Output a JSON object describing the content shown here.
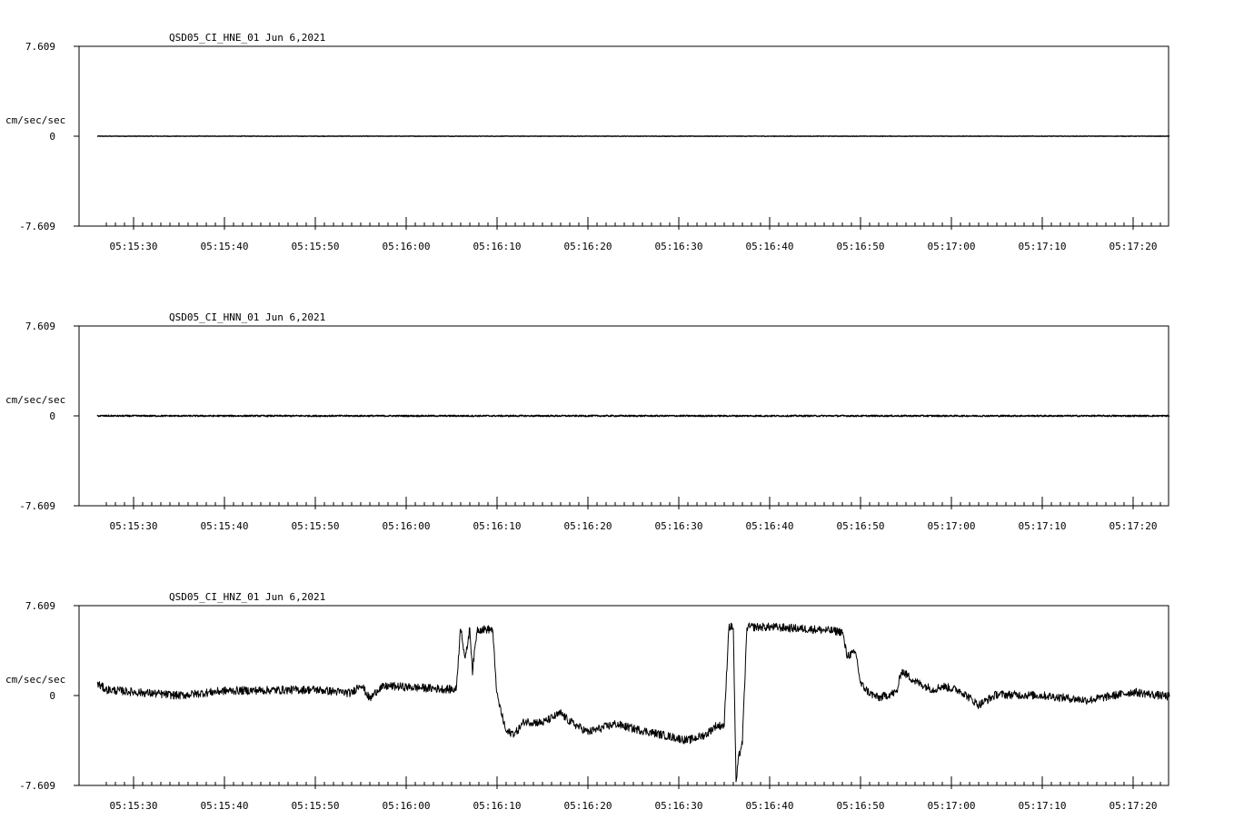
{
  "chart_data": [
    {
      "type": "line",
      "title": "QSD05_CI_HNE_01  Jun 6,2021",
      "ylabel": "cm/sec/sec",
      "ylim": [
        -7.609,
        7.609
      ],
      "y_ticks": [
        "7.609",
        "0",
        "-7.609"
      ],
      "x_ticks": [
        "05:15:30",
        "05:15:40",
        "05:15:50",
        "05:16:00",
        "05:16:10",
        "05:16:20",
        "05:16:30",
        "05:16:40",
        "05:16:50",
        "05:17:00",
        "05:17:10",
        "05:17:20"
      ],
      "series": [
        {
          "x": [
            "05:15:26",
            "05:15:40",
            "05:16:00",
            "05:16:20",
            "05:16:40",
            "05:17:00",
            "05:17:20",
            "05:17:24"
          ],
          "y": [
            0,
            0,
            0,
            0,
            0,
            0,
            0,
            0
          ]
        }
      ]
    },
    {
      "type": "line",
      "title": "QSD05_CI_HNN_01  Jun 6,2021",
      "ylabel": "cm/sec/sec",
      "ylim": [
        -7.609,
        7.609
      ],
      "y_ticks": [
        "7.609",
        "0",
        "-7.609"
      ],
      "x_ticks": [
        "05:15:30",
        "05:15:40",
        "05:15:50",
        "05:16:00",
        "05:16:10",
        "05:16:20",
        "05:16:30",
        "05:16:40",
        "05:16:50",
        "05:17:00",
        "05:17:10",
        "05:17:20"
      ],
      "series": [
        {
          "x": [
            "05:15:26",
            "05:15:40",
            "05:16:00",
            "05:16:20",
            "05:16:40",
            "05:17:00",
            "05:17:20",
            "05:17:24"
          ],
          "y": [
            0,
            0,
            0,
            0,
            0,
            0,
            0,
            0
          ]
        }
      ]
    },
    {
      "type": "line",
      "title": "QSD05_CI_HNZ_01  Jun 6,2021",
      "ylabel": "cm/sec/sec",
      "ylim": [
        -7.609,
        7.609
      ],
      "y_ticks": [
        "7.609",
        "0",
        "-7.609"
      ],
      "x_ticks": [
        "05:15:30",
        "05:15:40",
        "05:15:50",
        "05:16:00",
        "05:16:10",
        "05:16:20",
        "05:16:30",
        "05:16:40",
        "05:16:50",
        "05:17:00",
        "05:17:10",
        "05:17:20"
      ],
      "series": [
        {
          "x": [
            "05:15:26",
            "05:15:27",
            "05:15:30",
            "05:15:35",
            "05:15:40",
            "05:15:50",
            "05:15:54",
            "05:15:55",
            "05:15:56",
            "05:15:57",
            "05:15:58",
            "05:16:03",
            "05:16:05.5",
            "05:16:06",
            "05:16:06.5",
            "05:16:07",
            "05:16:07.3",
            "05:16:07.8",
            "05:16:08",
            "05:16:09.5",
            "05:16:10",
            "05:16:11",
            "05:16:12",
            "05:16:13",
            "05:16:15",
            "05:16:17",
            "05:16:18",
            "05:16:20",
            "05:16:23",
            "05:16:25",
            "05:16:28",
            "05:16:31",
            "05:16:33",
            "05:16:34",
            "05:16:35",
            "05:16:35.5",
            "05:16:36",
            "05:16:36.3",
            "05:16:36.6",
            "05:16:37",
            "05:16:37.5",
            "05:16:37.8",
            "05:16:40",
            "05:16:45",
            "05:16:48",
            "05:16:48.5",
            "05:16:49.5",
            "05:16:50",
            "05:16:51",
            "05:16:52",
            "05:16:54",
            "05:16:54.5",
            "05:16:56",
            "05:16:58",
            "05:16:59",
            "05:17:01",
            "05:17:03",
            "05:17:05",
            "05:17:10",
            "05:17:15",
            "05:17:20",
            "05:17:24"
          ],
          "y": [
            1.0,
            0.5,
            0.3,
            0.0,
            0.4,
            0.5,
            0.2,
            1.0,
            -0.3,
            0.6,
            0.8,
            0.6,
            0.5,
            5.9,
            3.0,
            5.7,
            2.1,
            5.6,
            5.6,
            5.6,
            0.0,
            -3.1,
            -3.2,
            -2.2,
            -2.3,
            -1.5,
            -2.2,
            -3.1,
            -2.4,
            -2.8,
            -3.3,
            -3.8,
            -3.3,
            -2.6,
            -2.5,
            5.8,
            5.8,
            -7.4,
            -5.2,
            -3.9,
            5.8,
            5.8,
            5.8,
            5.6,
            5.4,
            3.4,
            3.6,
            1.0,
            0.2,
            -0.2,
            0.3,
            2.1,
            1.2,
            0.5,
            0.8,
            0.4,
            -0.8,
            0.1,
            0.0,
            -0.4,
            0.3,
            -0.1
          ]
        }
      ]
    }
  ]
}
